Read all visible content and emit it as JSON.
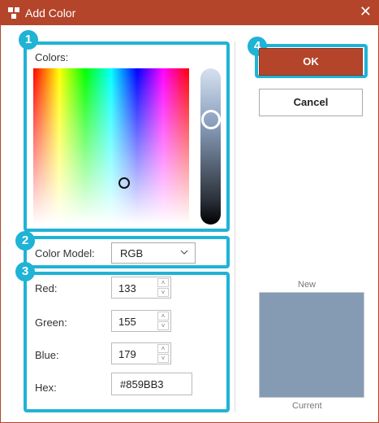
{
  "window": {
    "title": "Add Color",
    "close_icon": "close-icon",
    "accent": "#b4452b"
  },
  "callouts": {
    "color": "#1fb3d6",
    "labels": [
      "1",
      "2",
      "3",
      "4"
    ]
  },
  "picker": {
    "label": "Colors:"
  },
  "color_model": {
    "label": "Color Model:",
    "value": "RGB"
  },
  "fields": {
    "red": {
      "label": "Red:",
      "value": "133"
    },
    "green": {
      "label": "Green:",
      "value": "155"
    },
    "blue": {
      "label": "Blue:",
      "value": "179"
    },
    "hex": {
      "label": "Hex:",
      "value": "#859BB3"
    }
  },
  "buttons": {
    "ok": "OK",
    "cancel": "Cancel"
  },
  "preview": {
    "new_label": "New",
    "current_label": "Current",
    "color": "#859bb3"
  }
}
